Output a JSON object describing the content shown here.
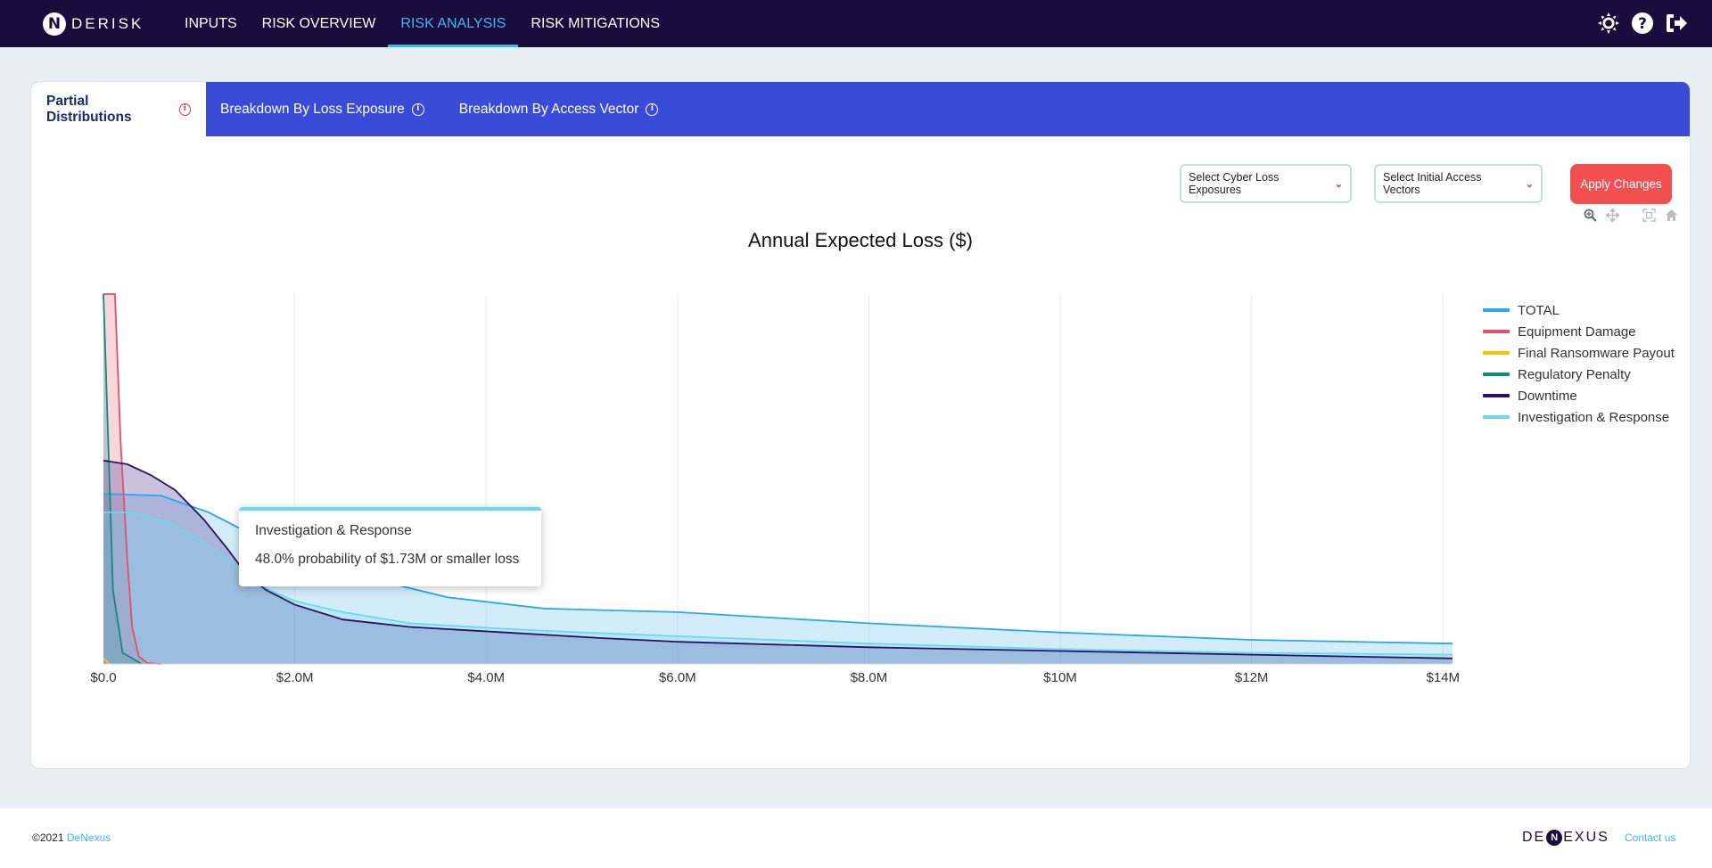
{
  "brand": {
    "logo_letter": "N",
    "name": "DERISK"
  },
  "nav": {
    "items": [
      {
        "label": "INPUTS",
        "active": false
      },
      {
        "label": "RISK OVERVIEW",
        "active": false
      },
      {
        "label": "RISK ANALYSIS",
        "active": true
      },
      {
        "label": "RISK MITIGATIONS",
        "active": false
      }
    ],
    "icons": [
      "theme-sun-icon",
      "help-icon",
      "logout-icon"
    ]
  },
  "tabs": [
    {
      "label": "Partial Distributions",
      "active": true
    },
    {
      "label": "Breakdown By Loss Exposure",
      "active": false
    },
    {
      "label": "Breakdown By Access Vector",
      "active": false
    }
  ],
  "filters": {
    "loss_exposures": "Select Cyber Loss Exposures",
    "access_vectors": "Select Initial Access Vectors",
    "apply": "Apply Changes"
  },
  "toolbar_icons": [
    "zoom-icon",
    "pan-icon",
    "fullscreen-icon",
    "home-icon"
  ],
  "colors": {
    "nav_bg": "#1a0c3c",
    "accent": "#3cb8f0",
    "tab_bg": "#3a4bd8",
    "apply": "#f25050"
  },
  "chart_data": {
    "type": "area",
    "title": "Annual Expected Loss ($)",
    "xlabel": "",
    "ylabel": "",
    "x_unit": "$M",
    "xlim": [
      0,
      14.1
    ],
    "x_ticks": [
      "$0.0",
      "$2.0M",
      "$4.0M",
      "$6.0M",
      "$8.0M",
      "$10M",
      "$12M",
      "$14M"
    ],
    "x_tick_values": [
      0,
      2,
      4,
      6,
      8,
      10,
      12,
      14
    ],
    "ylim": [
      0,
      1
    ],
    "grid": true,
    "legend_position": "top-right",
    "series": [
      {
        "name": "TOTAL",
        "color": "#2aa8ee",
        "fill": "rgba(125,200,240,0.35)",
        "x": [
          0,
          0.6,
          1.1,
          1.7,
          2.3,
          2.8,
          3.6,
          4.6,
          6.0,
          8.0,
          10.0,
          12.0,
          14.1
        ],
        "y": [
          0.46,
          0.455,
          0.41,
          0.33,
          0.28,
          0.23,
          0.18,
          0.15,
          0.14,
          0.11,
          0.085,
          0.065,
          0.055
        ]
      },
      {
        "name": "Equipment Damage",
        "color": "#e05068",
        "fill": "rgba(228,110,130,0.28)",
        "x": [
          0,
          0.12,
          0.18,
          0.25,
          0.3,
          0.37,
          0.46,
          0.6
        ],
        "y": [
          1.0,
          1.0,
          0.6,
          0.28,
          0.1,
          0.02,
          0.002,
          0
        ]
      },
      {
        "name": "Final Ransomware Payout",
        "color": "#f2c40c",
        "fill": "rgba(242,196,12,0.12)",
        "x": [
          0,
          0.03,
          0.06
        ],
        "y": [
          0.015,
          0.008,
          0
        ]
      },
      {
        "name": "Regulatory Penalty",
        "color": "#138a7e",
        "fill": "rgba(19,138,126,0.25)",
        "x": [
          0,
          0.05,
          0.1,
          0.2,
          0.4
        ],
        "y": [
          1.0,
          0.6,
          0.2,
          0.03,
          0
        ]
      },
      {
        "name": "Downtime",
        "color": "#2a1260",
        "fill": "rgba(100,80,160,0.35)",
        "x": [
          0,
          0.25,
          0.5,
          0.75,
          1.05,
          1.3,
          1.5,
          1.7,
          2.0,
          2.5,
          3.2,
          4.2,
          5.2,
          6.0,
          8.0,
          10.0,
          12.0,
          14.1
        ],
        "y": [
          0.55,
          0.54,
          0.51,
          0.47,
          0.39,
          0.31,
          0.24,
          0.2,
          0.16,
          0.12,
          0.1,
          0.085,
          0.07,
          0.06,
          0.045,
          0.035,
          0.025,
          0.015
        ]
      },
      {
        "name": "Investigation & Response",
        "color": "#6cd8f0",
        "fill": "rgba(108,216,240,0.25)",
        "x": [
          0,
          0.3,
          0.7,
          1.1,
          1.5,
          1.73,
          2.0,
          2.5,
          3.2,
          4.2,
          5.0,
          6.0,
          8.0,
          10.0,
          12.0,
          14.1
        ],
        "y": [
          0.41,
          0.41,
          0.38,
          0.32,
          0.24,
          0.2,
          0.17,
          0.14,
          0.11,
          0.095,
          0.085,
          0.075,
          0.055,
          0.04,
          0.03,
          0.025
        ]
      }
    ],
    "tooltip": {
      "series": "Investigation & Response",
      "text": "48.0% probability of $1.73M or smaller loss"
    }
  },
  "footer": {
    "copyright": "©2021",
    "company_link": "DeNexus",
    "logo_left": "DE",
    "logo_mid": "N",
    "logo_right": "EXUS",
    "contact": "Contact us"
  }
}
